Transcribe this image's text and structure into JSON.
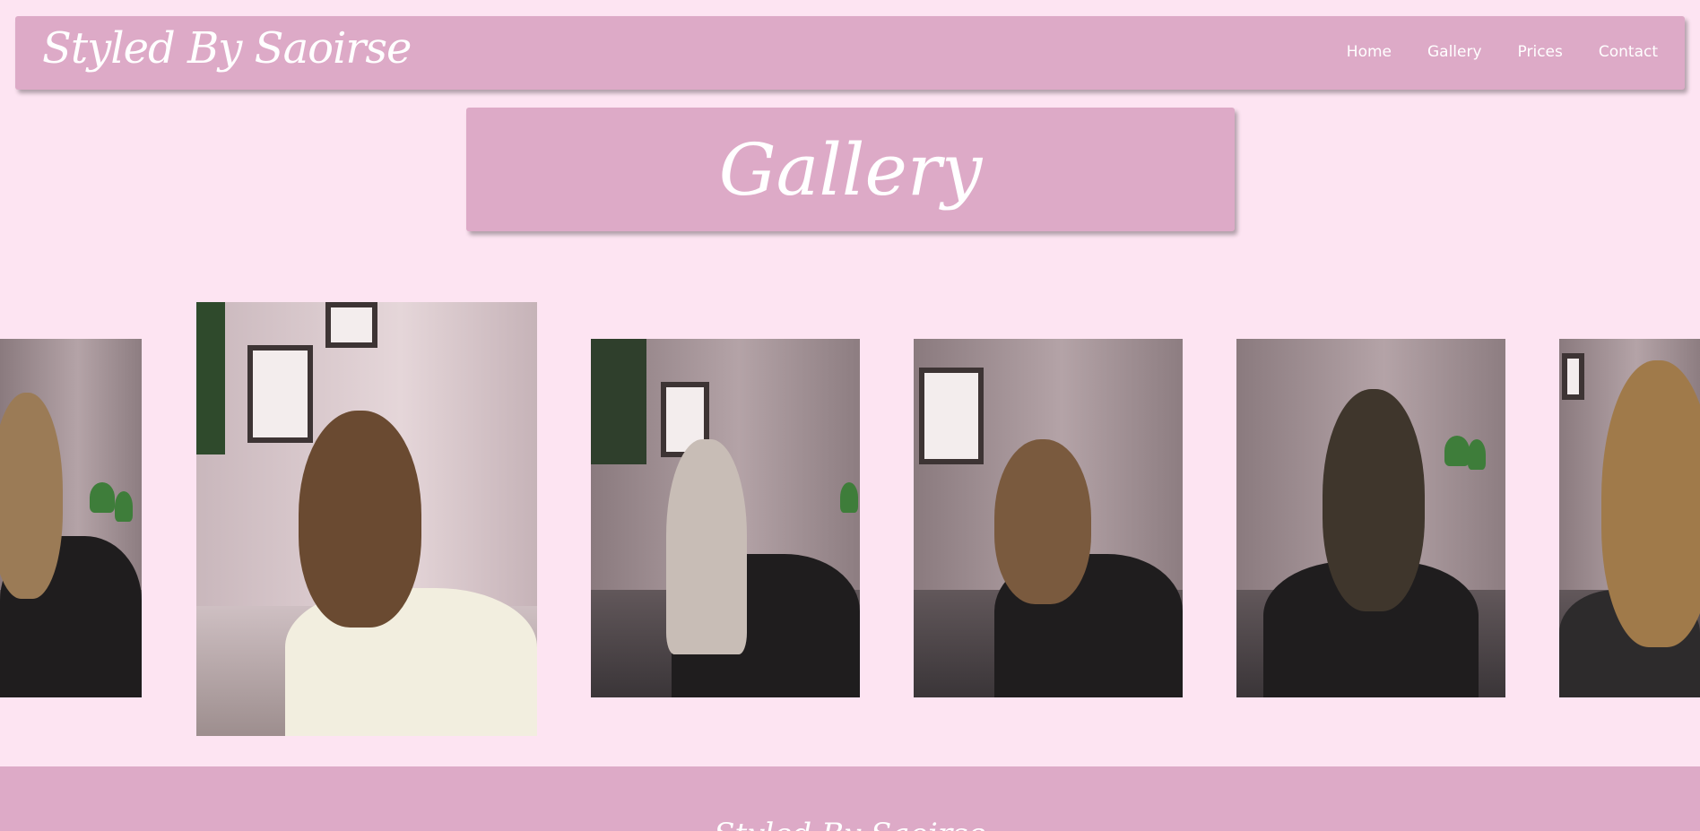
{
  "header": {
    "brand": "Styled By Saoirse",
    "nav": [
      {
        "label": "Home"
      },
      {
        "label": "Gallery"
      },
      {
        "label": "Prices"
      },
      {
        "label": "Contact"
      }
    ]
  },
  "main": {
    "title": "Gallery"
  },
  "footer": {
    "brand": "Styled By Saoirse"
  },
  "colors": {
    "background": "#fde4f2",
    "panel": "#ddaac7",
    "text": "#ffffff"
  }
}
